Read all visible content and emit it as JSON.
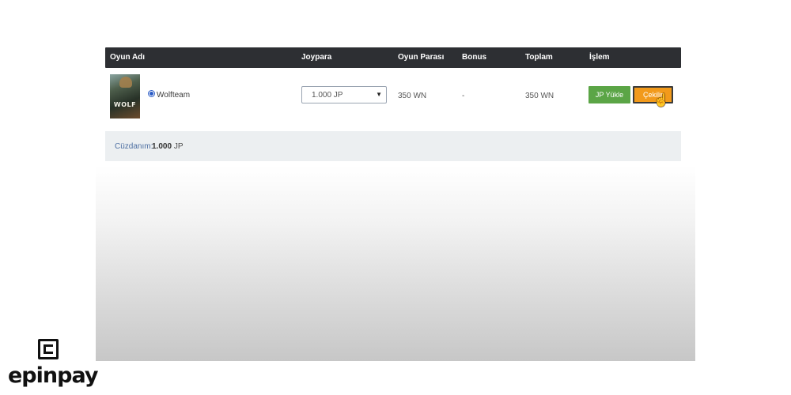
{
  "table": {
    "headers": [
      "Oyun Adı",
      "Joypara",
      "Oyun Parası",
      "Bonus",
      "Toplam",
      "İşlem"
    ],
    "row": {
      "thumbnail_text": "WOLF",
      "game_name": "Wolfteam",
      "joypara_selected": "1.000 JP",
      "oyun_parasi": "350 WN",
      "bonus": "-",
      "toplam": "350 WN",
      "buttons": {
        "load": "JP Yükle",
        "withdraw": "Çekilir"
      }
    }
  },
  "wallet": {
    "label": "Cüzdanım:",
    "amount": "1.000",
    "unit": "JP"
  },
  "brand": {
    "name": "epinpay",
    "icon": "epinpay-logo-icon"
  },
  "colors": {
    "header_bg": "#2d2f33",
    "load_button": "#5ba546",
    "withdraw_button": "#f29a1b",
    "wallet_bg": "#eceff1"
  },
  "icons": {
    "dropdown": "chevron-down-icon",
    "cursor": "hand-pointer-icon",
    "radio": "radio-selected-icon"
  }
}
